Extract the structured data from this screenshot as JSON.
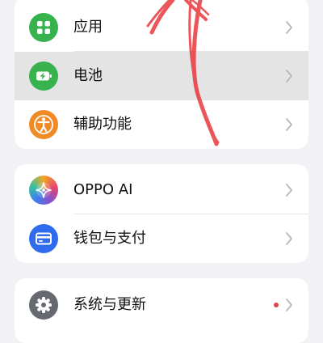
{
  "colors": {
    "background": "#f2f2f6",
    "card": "#ffffff",
    "highlight_row": "#e4e4e4",
    "chevron": "#b8b8bc",
    "scribble": "#e8393f"
  },
  "card1": {
    "items": [
      {
        "label": "应用",
        "icon": "apps-grid-icon",
        "icon_color": "#37b24d"
      },
      {
        "label": "电池",
        "icon": "battery-charging-icon",
        "icon_color": "#37b24d",
        "highlighted": true
      },
      {
        "label": "辅助功能",
        "icon": "accessibility-person-icon",
        "icon_color": "#f08a24"
      }
    ]
  },
  "card2": {
    "items": [
      {
        "label": "OPPO AI",
        "icon": "oppo-ai-sparkle-icon",
        "icon_color": "#8e4ec6"
      },
      {
        "label": "钱包与支付",
        "icon": "wallet-card-icon",
        "icon_color": "#2f6bed"
      }
    ]
  },
  "card3": {
    "items": [
      {
        "label": "系统与更新",
        "icon": "gear-icon",
        "icon_color": "#666a70",
        "badge_color": "#e0434a"
      }
    ]
  }
}
